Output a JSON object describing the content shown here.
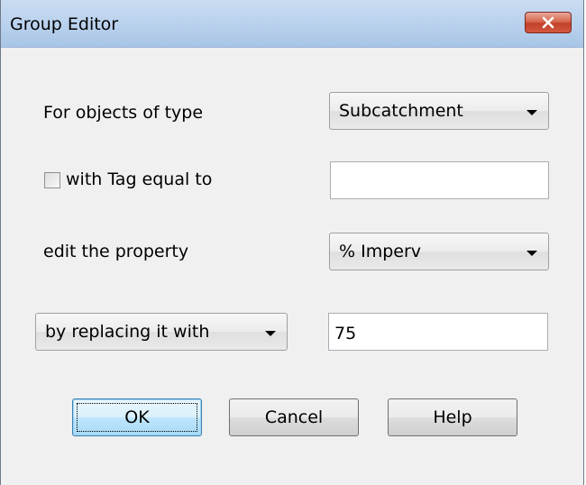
{
  "window": {
    "title": "Group Editor"
  },
  "form": {
    "object_type_label": "For objects of type",
    "object_type_value": "Subcatchment",
    "tag_checkbox_label": "with Tag equal to",
    "tag_checked": false,
    "tag_value": "",
    "property_label": "edit the property",
    "property_value": "% Imperv",
    "action_value": "by replacing it with",
    "replacement_value": "75"
  },
  "buttons": {
    "ok": "OK",
    "cancel": "Cancel",
    "help": "Help"
  },
  "icons": {
    "close": "close-icon",
    "dropdown": "chevron-down-icon"
  },
  "colors": {
    "close_button": "#c94a33",
    "title_bar": "#bcd3ee",
    "dialog_bg": "#f0f0f0",
    "default_button": "#bee6fd"
  }
}
